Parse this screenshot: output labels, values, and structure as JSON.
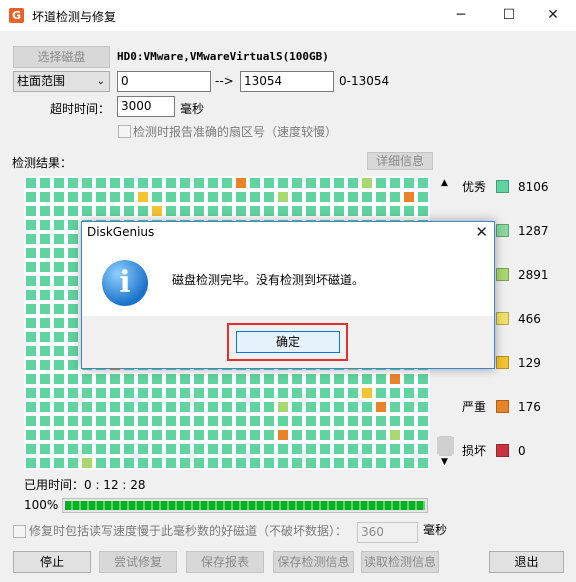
{
  "window": {
    "title": "坏道检测与修复",
    "minimize_glyph": "─",
    "maximize_glyph": "☐",
    "close_glyph": "✕"
  },
  "disk": {
    "select_button": "选择磁盘",
    "name": "HD0:VMware,VMwareVirtualS(100GB)"
  },
  "range": {
    "mode": "柱面范围",
    "start": "0",
    "arrow": "-->",
    "end": "13054",
    "hint": "0-13054"
  },
  "timeout": {
    "label": "超时时间：",
    "value": "3000",
    "unit": "毫秒"
  },
  "report_option": "检测时报告准确的扇区号（速度较慢）",
  "results": {
    "label": "检测结果：",
    "detail_button": "详细信息"
  },
  "legend": [
    {
      "label": "优秀",
      "count": "8106",
      "color": "#5fd3a0"
    },
    {
      "label": "",
      "count": "1287",
      "color": "#88d9a0"
    },
    {
      "label": "",
      "count": "2891",
      "color": "#a8d870"
    },
    {
      "label": "",
      "count": "466",
      "color": "#f2e06a"
    },
    {
      "label": "",
      "count": "129",
      "color": "#f2c431"
    },
    {
      "label": "严重",
      "count": "176",
      "color": "#e8832a"
    },
    {
      "label": "损坏",
      "count": "0",
      "color": "#c8333f"
    }
  ],
  "grid_colors": {
    "normal": "#5fd3a0",
    "light": "#a8d870",
    "yellow": "#f2c431",
    "orange": "#e8832a"
  },
  "elapsed": {
    "label": "已用时间：",
    "value": "0 : 12 : 28"
  },
  "progress": {
    "percent_text": "100%",
    "fraction": 1.0
  },
  "repair_option": {
    "label": "修复时包括读写速度慢于此毫秒数的好磁道（不破坏数据）：",
    "value": "360",
    "unit": "毫秒"
  },
  "buttons": {
    "stop": "停止",
    "try_repair": "尝试修复",
    "save_report": "保存报表",
    "save_info": "保存检测信息",
    "load_info": "读取检测信息",
    "exit": "退出"
  },
  "dialog": {
    "title": "DiskGenius",
    "close_glyph": "✕",
    "icon_glyph": "i",
    "message": "磁盘检测完毕。没有检测到坏磁道。",
    "ok": "确定"
  }
}
